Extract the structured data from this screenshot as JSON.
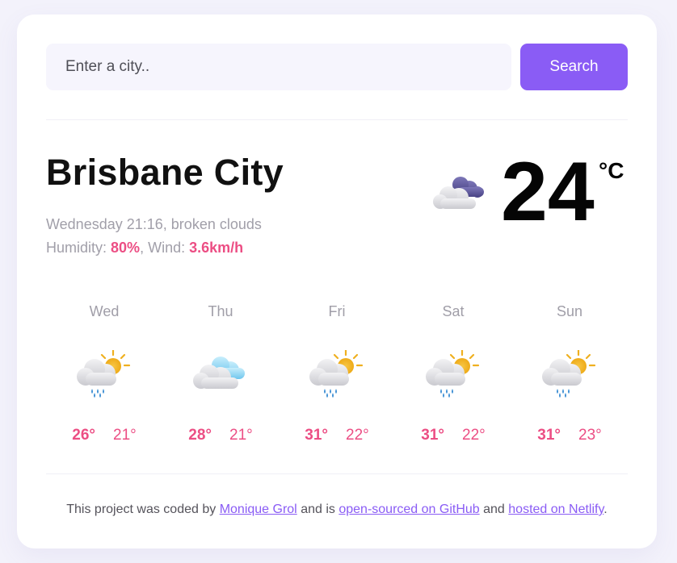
{
  "search": {
    "placeholder": "Enter a city..",
    "button_label": "Search"
  },
  "current": {
    "city": "Brisbane City",
    "datetime": "Wednesday 21:16",
    "description": "broken clouds",
    "humidity_label": "Humidity:",
    "humidity_value": "80%",
    "wind_label": "Wind:",
    "wind_value": "3.6km/h",
    "temperature": "24",
    "unit": "°C",
    "icon": "broken-clouds-icon"
  },
  "forecast": [
    {
      "day": "Wed",
      "max": "26°",
      "min": "21°",
      "icon": "rain-sun-icon"
    },
    {
      "day": "Thu",
      "max": "28°",
      "min": "21°",
      "icon": "cloudy-icon"
    },
    {
      "day": "Fri",
      "max": "31°",
      "min": "22°",
      "icon": "rain-sun-icon"
    },
    {
      "day": "Sat",
      "max": "31°",
      "min": "22°",
      "icon": "rain-sun-icon"
    },
    {
      "day": "Sun",
      "max": "31°",
      "min": "23°",
      "icon": "rain-sun-icon"
    }
  ],
  "footer": {
    "text_1": "This project was coded by",
    "author_link": "Monique Grol",
    "text_2": "and is",
    "github_link": "open-sourced on GitHub",
    "text_3": "and",
    "netlify_link": "hosted on Netlify",
    "text_4": "."
  },
  "colors": {
    "accent": "#8a5cf5",
    "highlight": "#ec4e84",
    "muted": "#a19fa9"
  }
}
